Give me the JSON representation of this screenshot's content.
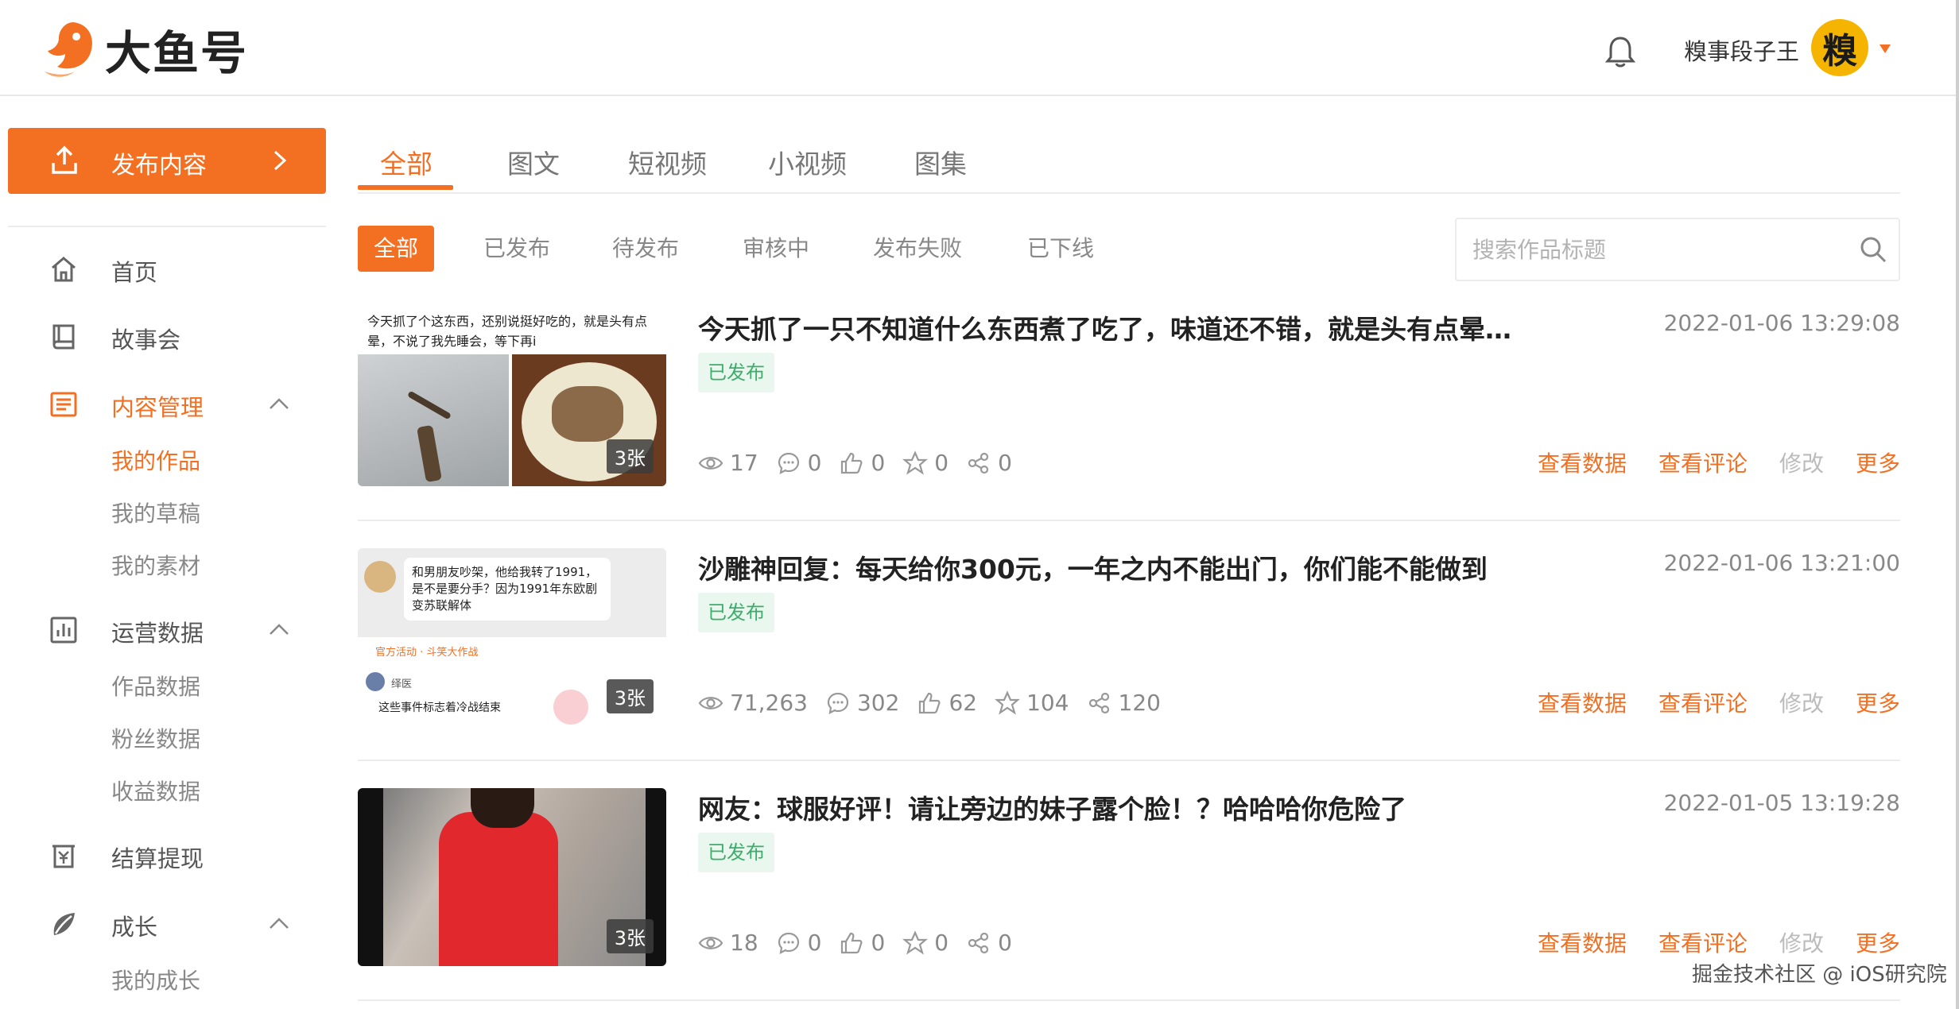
{
  "header": {
    "logo_text": "大鱼号",
    "username": "糗事段子王",
    "avatar_text": "糗"
  },
  "sidebar": {
    "publish_label": "发布内容",
    "items": [
      {
        "label": "首页",
        "icon": "home-icon"
      },
      {
        "label": "故事会",
        "icon": "book-icon"
      },
      {
        "label": "内容管理",
        "icon": "document-list-icon"
      },
      {
        "label": "运营数据",
        "icon": "bar-chart-icon"
      },
      {
        "label": "结算提现",
        "icon": "wallet-icon"
      },
      {
        "label": "成长",
        "icon": "leaf-icon"
      }
    ],
    "content_sub": [
      "我的作品",
      "我的草稿",
      "我的素材"
    ],
    "data_sub": [
      "作品数据",
      "粉丝数据",
      "收益数据"
    ],
    "growth_sub": [
      "我的成长"
    ]
  },
  "type_tabs": [
    "全部",
    "图文",
    "短视频",
    "小视频",
    "图集"
  ],
  "status_filters": [
    "全部",
    "已发布",
    "待发布",
    "审核中",
    "发布失败",
    "已下线"
  ],
  "search": {
    "placeholder": "搜索作品标题"
  },
  "colors": {
    "accent": "#f36f21",
    "published_bg": "#eaf7ef",
    "published_text": "#3cae6b"
  },
  "works": [
    {
      "title": "今天抓了一只不知道什么东西煮了吃了，味道还不错，就是头有点晕…",
      "date": "2022-01-06 13:29:08",
      "status": "已发布",
      "thumb_caption": "今天抓了个这东西，还别说挺好吃的，就是头有点晕，不说了我先睡会，等下再i",
      "image_count": "3张",
      "views": "17",
      "comments": "0",
      "likes": "0",
      "favorites": "0",
      "shares": "0"
    },
    {
      "title": "沙雕神回复：每天给你300元，一年之内不能出门，你们能不能做到",
      "date": "2022-01-06 13:21:00",
      "status": "已发布",
      "thumb_bubble": "和男朋友吵架，他给我转了1991，是不是要分手？因为1991年东欧剧变苏联解体",
      "thumb_activity": "官方活动 · 斗笑大作战",
      "thumb_user": "绎医",
      "thumb_reply": "这些事件标志着冷战结束",
      "image_count": "3张",
      "views": "71,263",
      "comments": "302",
      "likes": "62",
      "favorites": "104",
      "shares": "120"
    },
    {
      "title": "网友：球服好评！请让旁边的妹子露个脸！？哈哈哈你危险了",
      "date": "2022-01-05 13:19:28",
      "status": "已发布",
      "image_count": "3张",
      "views": "18",
      "comments": "0",
      "likes": "0",
      "favorites": "0",
      "shares": "0"
    }
  ],
  "row_actions": {
    "view_data": "查看数据",
    "view_comments": "查看评论",
    "edit": "修改",
    "more": "更多"
  },
  "watermark": "掘金技术社区 @ iOS研究院"
}
